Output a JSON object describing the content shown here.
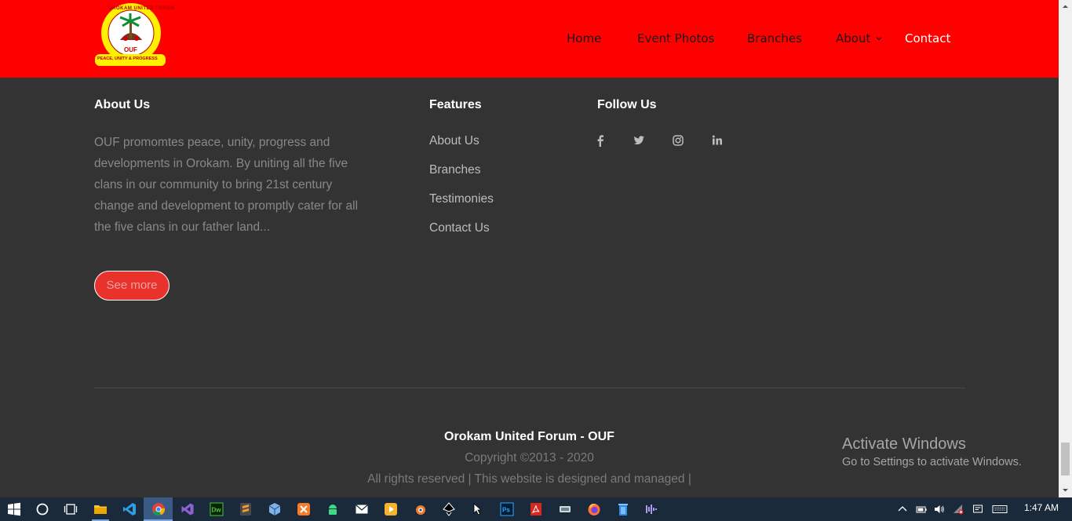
{
  "header": {
    "logo": {
      "ring_text": "OROKAM UNITED FORUM",
      "center_text": "OUF",
      "motto": "PEACE, UNITY & PROGRESS"
    },
    "nav": [
      {
        "label": "Home"
      },
      {
        "label": "Event Photos"
      },
      {
        "label": "Branches"
      },
      {
        "label": "About"
      },
      {
        "label": "Contact"
      }
    ]
  },
  "footer": {
    "about": {
      "title": "About Us",
      "text": "OUF promomtes peace, unity, progress and developments in Orokam. By uniting all the five clans in our community to bring 21st century change and development to promptly cater for all the five clans in our father land...",
      "button": "See more"
    },
    "features": {
      "title": "Features",
      "links": [
        "About Us",
        "Branches",
        "Testimonies",
        "Contact Us"
      ]
    },
    "follow": {
      "title": "Follow Us",
      "icons": [
        "facebook-icon",
        "twitter-icon",
        "instagram-icon",
        "linkedin-icon"
      ]
    },
    "bottom": {
      "brand": "Orokam United Forum - OUF",
      "copyright": "Copyright ©2013 - 2020",
      "rights": "All rights reserved | This website is designed and managed |"
    }
  },
  "watermark": {
    "title": "Activate Windows",
    "subtitle": "Go to Settings to activate Windows."
  },
  "taskbar": {
    "time": "1:47 AM",
    "apps": [
      "start-icon",
      "cortana-icon",
      "task-view-icon",
      "file-explorer-icon",
      "vscode-icon",
      "chrome-icon",
      "visual-studio-icon",
      "dreamweaver-icon",
      "sublime-icon",
      "virtualbox-icon",
      "xampp-icon",
      "android-icon",
      "mail-icon",
      "media-player-icon",
      "blender-icon",
      "inkscape-icon",
      "cursor-tool-icon",
      "photoshop-icon",
      "acrobat-icon",
      "network-app-icon",
      "firefox-icon",
      "recycle-icon",
      "audio-app-icon"
    ]
  },
  "colors": {
    "header_bg": "#ff0000",
    "footer_bg": "#333333",
    "button_bg": "#e8322b"
  }
}
